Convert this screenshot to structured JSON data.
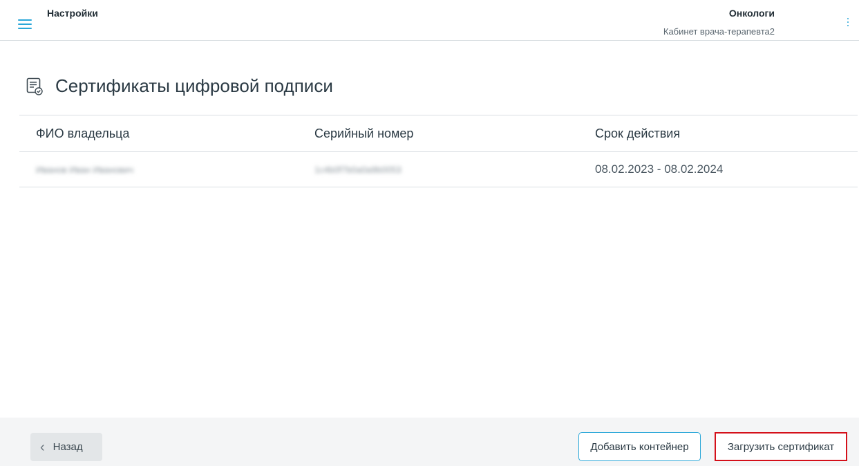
{
  "header": {
    "title": "Настройки",
    "organization": "Онкологи",
    "cabinet": "Кабинет врача-терапевта2",
    "accent_color": "#2aa7d8"
  },
  "page": {
    "title": "Сертификаты цифровой подписи",
    "icon": "certificate-doc-icon"
  },
  "table": {
    "columns": [
      "ФИО владельца",
      "Серийный номер",
      "Срок действия"
    ],
    "rows": [
      {
        "owner": "Иванов Иван Иванович",
        "serial": "1c4b0f7b0a0a9b0053",
        "validity": "08.02.2023 - 08.02.2024"
      }
    ]
  },
  "footer": {
    "back_label": "Назад",
    "add_container_label": "Добавить контейнер",
    "upload_certificate_label": "Загрузить сертификат",
    "highlight_color": "#d4101a"
  }
}
